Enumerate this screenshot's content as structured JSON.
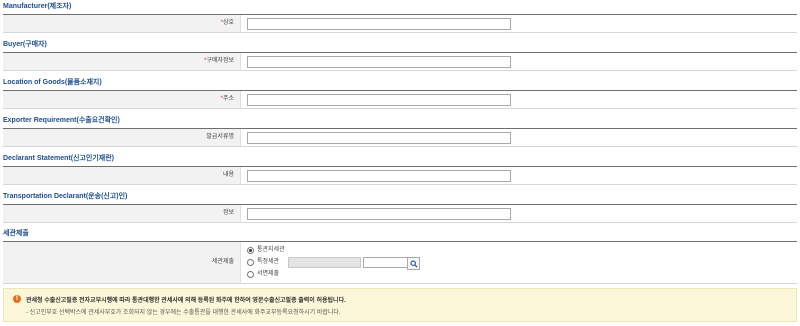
{
  "sections": [
    {
      "title": "Manufacturer(제조자)",
      "label": "상호",
      "required": true
    },
    {
      "title": "Buyer(구매자)",
      "label": "구매자정보",
      "required": true
    },
    {
      "title": "Location of Goods(물품소재지)",
      "label": "주소",
      "required": true
    },
    {
      "title": "Exporter Requirement(수출요건확인)",
      "label": "발급서류명",
      "required": false
    },
    {
      "title": "Declarant Statement(신고인기재란)",
      "label": "내용",
      "required": false
    },
    {
      "title": "Transportation Declarant(운송(신고)인)",
      "label": "정보",
      "required": false
    }
  ],
  "customs": {
    "title": "세관제출",
    "label": "세관제출",
    "options": [
      "통관지세관",
      "특정세관",
      "서면제출"
    ],
    "selected_option": "통관지세관"
  },
  "notice": {
    "line1": "관세청 수출신고필증 전자교부시행에 따라 통관대행한 관세사에 의해 등록된 화주에 한하여 영문수출신고필증 출력이 허용됩니다.",
    "line2": "- 신고인부호 선택박스에 관세사부호가 조회되지 않는 경우에는 수출통관을 대행한 관세사에 화주교부등록요청하시기 바랍니다.",
    "icon": "warning-icon",
    "icon_glyph": "!"
  },
  "required_mark": "*"
}
